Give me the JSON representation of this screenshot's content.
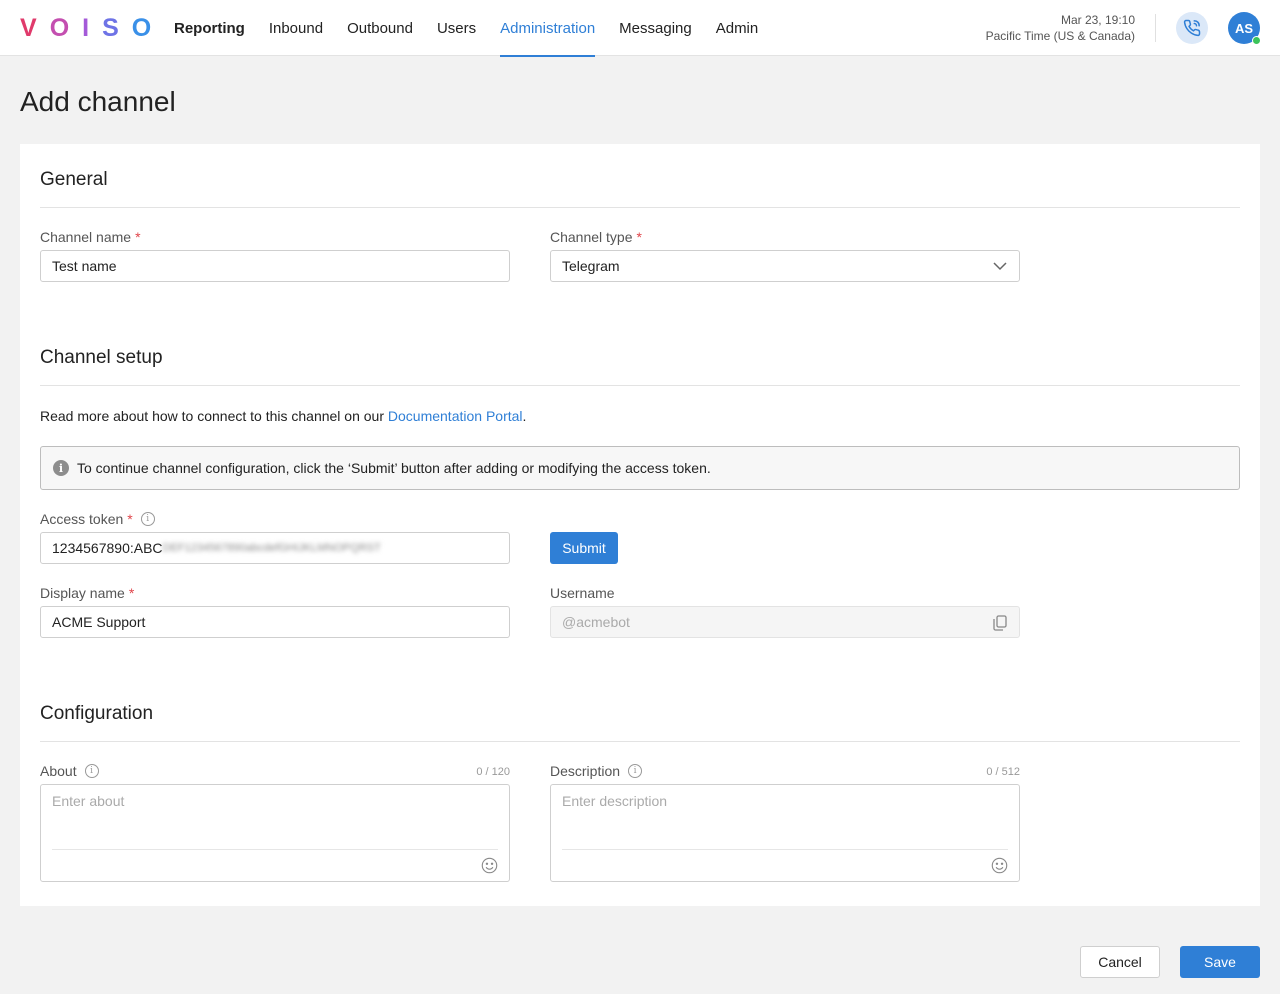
{
  "brand": {
    "letters": [
      "V",
      "O",
      "I",
      "S",
      "O"
    ],
    "colors": [
      "#e03a6b",
      "#c44fb0",
      "#a45ad8",
      "#6e73e6",
      "#3a90e8"
    ]
  },
  "nav": {
    "items": [
      {
        "label": "Reporting"
      },
      {
        "label": "Inbound"
      },
      {
        "label": "Outbound"
      },
      {
        "label": "Users"
      },
      {
        "label": "Administration"
      },
      {
        "label": "Messaging"
      },
      {
        "label": "Admin"
      }
    ],
    "active": "Administration"
  },
  "header": {
    "datetime": "Mar 23, 19:10",
    "timezone": "Pacific Time (US & Canada)",
    "avatar_initials": "AS"
  },
  "page": {
    "title": "Add channel"
  },
  "general": {
    "title": "General",
    "channel_name_label": "Channel name",
    "channel_name_value": "Test name",
    "channel_type_label": "Channel type",
    "channel_type_value": "Telegram",
    "required_mark": "*"
  },
  "setup": {
    "title": "Channel setup",
    "help_prefix": "Read more about how to connect to this channel on our ",
    "help_link": "Documentation Portal",
    "help_suffix": ".",
    "notice": "To continue channel configuration, click the ‘Submit’ button after adding or modifying the access token.",
    "access_token_label": "Access token",
    "access_token_visible": "1234567890:ABC",
    "access_token_hidden": "DEF1234567890abcdefGHIJKLMNOPQRST",
    "submit_label": "Submit",
    "display_name_label": "Display name",
    "display_name_value": "ACME Support",
    "username_label": "Username",
    "username_value": "@acmebot"
  },
  "configuration": {
    "title": "Configuration",
    "about_label": "About",
    "about_counter": "0 / 120",
    "about_placeholder": "Enter about",
    "description_label": "Description",
    "description_counter": "0 / 512",
    "description_placeholder": "Enter description"
  },
  "footer": {
    "cancel_label": "Cancel",
    "save_label": "Save"
  },
  "colors": {
    "accent": "#2f7fd6",
    "required": "#e0444a",
    "online": "#3cc45a"
  }
}
